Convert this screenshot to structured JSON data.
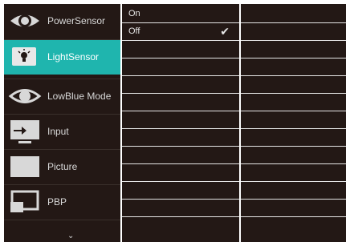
{
  "sidebar": {
    "items": [
      {
        "label": "PowerSensor",
        "icon": "eye-icon",
        "active": false
      },
      {
        "label": "LightSensor",
        "icon": "lightbulb-icon",
        "active": true
      },
      {
        "label": "LowBlue Mode",
        "icon": "lowblue-eye-icon",
        "active": false
      },
      {
        "label": "Input",
        "icon": "input-icon",
        "active": false
      },
      {
        "label": "Picture",
        "icon": "picture-icon",
        "active": false
      },
      {
        "label": "PBP",
        "icon": "pbp-icon",
        "active": false
      }
    ],
    "more": "⌄"
  },
  "submenu": {
    "options": [
      {
        "label": "On",
        "selected": false
      },
      {
        "label": "Off",
        "selected": true
      }
    ],
    "check_mark": "✔"
  },
  "colors": {
    "background": "#231815",
    "accent": "#1fb5ae",
    "text": "#d8d8d8"
  }
}
